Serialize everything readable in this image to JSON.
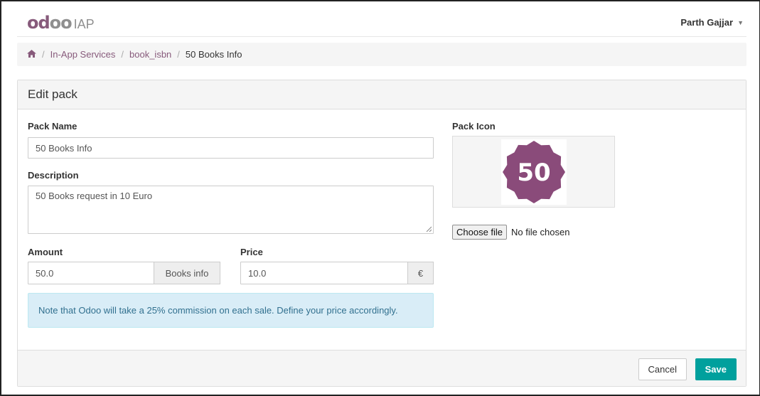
{
  "navbar": {
    "brand_logo": "odoo",
    "brand_suffix": "IAP",
    "user_name": "Parth Gajjar"
  },
  "breadcrumb": {
    "home_icon": "home-icon",
    "items": [
      "In-App Services",
      "book_isbn"
    ],
    "active": "50 Books Info"
  },
  "panel": {
    "heading": "Edit pack"
  },
  "form": {
    "pack_name_label": "Pack Name",
    "pack_name_value": "50 Books Info",
    "description_label": "Description",
    "description_value": "50 Books request in 10 Euro",
    "amount_label": "Amount",
    "amount_value": "50.0",
    "amount_unit": "Books info",
    "price_label": "Price",
    "price_value": "10.0",
    "price_currency": "€",
    "note": "Note that Odoo will take a 25% commission on each sale. Define your price accordingly."
  },
  "pack_icon": {
    "label": "Pack Icon",
    "badge_text": "50",
    "badge_color": "#8a4b7a",
    "file_button": "Choose file",
    "file_status": "No file chosen"
  },
  "footer": {
    "cancel_label": "Cancel",
    "save_label": "Save"
  },
  "colors": {
    "brand": "#875a7b",
    "primary_button": "#00a09d",
    "info_bg": "#d9edf7",
    "info_text": "#31708f"
  }
}
